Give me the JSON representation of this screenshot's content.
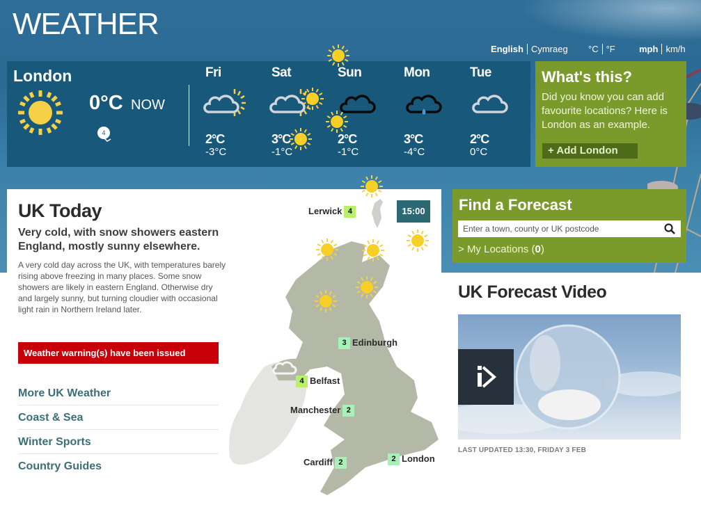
{
  "header": {
    "title": "WEATHER",
    "language": {
      "active": "English",
      "other": "Cymraeg"
    },
    "temp_units": {
      "active": "°C",
      "other": "°F"
    },
    "speed_units": {
      "active": "mph",
      "other": "km/h"
    }
  },
  "current": {
    "location": "London",
    "icon": "sun-icon",
    "temp": "0°C",
    "now_label": "NOW",
    "wind_speed": "4"
  },
  "days": [
    {
      "name": "Fri",
      "icon": "sunny-intervals-icon",
      "high": "2°C",
      "low": "-3°C"
    },
    {
      "name": "Sat",
      "icon": "sunny-intervals-icon",
      "high": "3°C",
      "low": "-1°C"
    },
    {
      "name": "Sun",
      "icon": "thick-cloud-icon",
      "high": "2°C",
      "low": "-1°C"
    },
    {
      "name": "Mon",
      "icon": "light-rain-icon",
      "high": "3°C",
      "low": "-4°C"
    },
    {
      "name": "Tue",
      "icon": "light-cloud-icon",
      "high": "2°C",
      "low": "0°C"
    }
  ],
  "whats_this": {
    "title": "What's this?",
    "text": "Did you know you can add favourite locations? Here is London as an example.",
    "button": "+ Add London"
  },
  "uk_today": {
    "title": "UK Today",
    "summary": "Very cold, with snow showers eastern England, mostly sunny elsewhere.",
    "body": "A very cold day across the UK, with temperatures barely rising above freezing in many places. Some snow showers are likely in eastern England. Otherwise dry and largely sunny, but turning cloudier with occasional light rain in Northern Ireland later.",
    "warning": "Weather warning(s) have been issued",
    "links": [
      "More UK Weather",
      "Coast & Sea",
      "Winter Sports",
      "Country Guides"
    ],
    "map_time": "15:00",
    "cities": [
      {
        "name": "Lerwick",
        "temp": "4",
        "color": "#b8f06a"
      },
      {
        "name": "Edinburgh",
        "temp": "3",
        "color": "#a8f0b8"
      },
      {
        "name": "Belfast",
        "temp": "4",
        "color": "#b8f06a"
      },
      {
        "name": "Manchester",
        "temp": "2",
        "color": "#a8f0b8"
      },
      {
        "name": "Cardiff",
        "temp": "2",
        "color": "#a8f0b8"
      },
      {
        "name": "London",
        "temp": "2",
        "color": "#a8f0b8"
      }
    ]
  },
  "find_forecast": {
    "title": "Find a Forecast",
    "placeholder": "Enter a town, county or UK postcode",
    "my_locations_label": "My Locations (",
    "my_locations_count": "0",
    "my_locations_close": ")"
  },
  "video": {
    "title": "UK Forecast Video",
    "updated": "LAST UPDATED 13:30, FRIDAY 3 FEB"
  }
}
